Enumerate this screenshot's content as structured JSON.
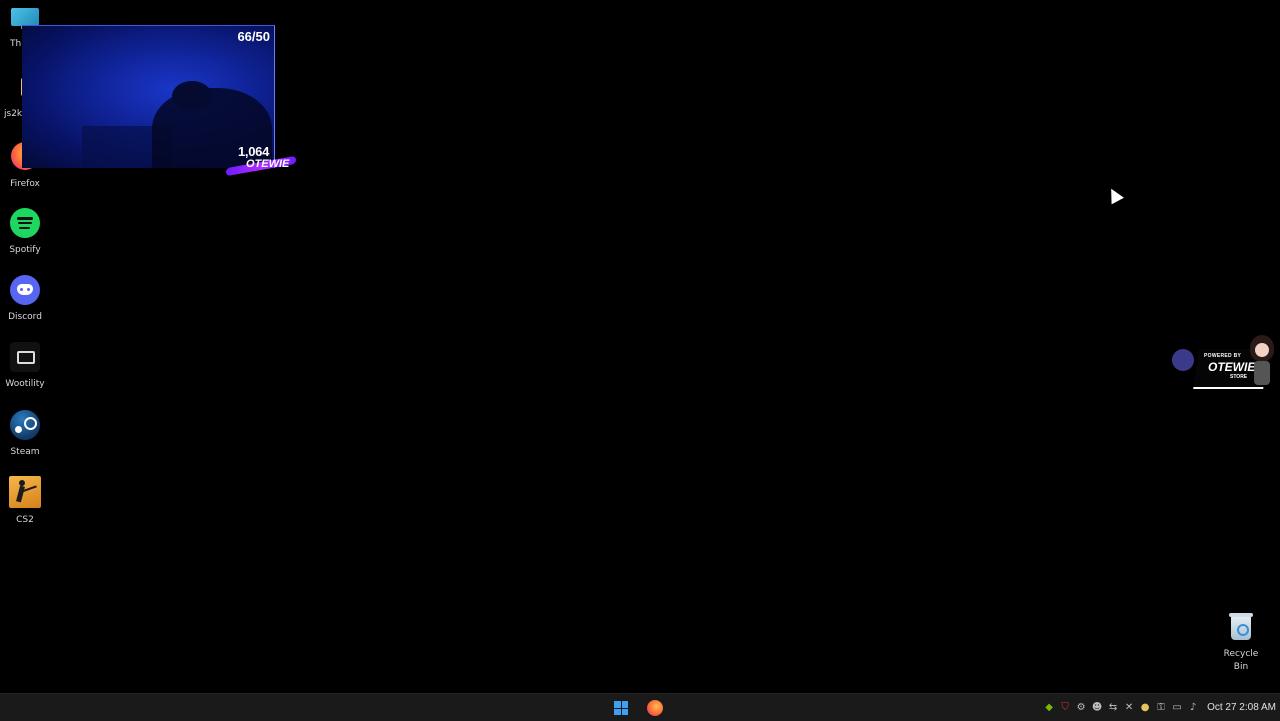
{
  "desktop": {
    "icons": [
      {
        "label": "Thi",
        "icon": "this-pc-icon"
      },
      {
        "label": "js2k",
        "icon": "folder-icon"
      },
      {
        "label": "Firefox",
        "icon": "firefox-icon"
      },
      {
        "label": "Spotify",
        "icon": "spotify-icon"
      },
      {
        "label": "Discord",
        "icon": "discord-icon"
      },
      {
        "label": "Wootility",
        "icon": "wootility-icon"
      },
      {
        "label": "Steam",
        "icon": "steam-icon"
      },
      {
        "label": "CS2",
        "icon": "cs2-icon"
      }
    ],
    "recycle_bin": {
      "label_line1": "Recycle",
      "label_line2": "Bin"
    }
  },
  "stream_overlay": {
    "goal_counter": "66/50",
    "sub_count": "1,064",
    "brand": "OTEWIE"
  },
  "powered_widget": {
    "line1": "POWERED BY",
    "name": "OTEWIE",
    "line3": "STORE"
  },
  "taskbar": {
    "clock": "Oct 27  2:08 AM",
    "pinned": [
      {
        "icon": "windows-start-icon"
      },
      {
        "icon": "firefox-icon"
      }
    ],
    "tray_icons": [
      "nvidia-icon",
      "shield-icon",
      "steam-icon",
      "discord-icon",
      "network-icon",
      "close-icon",
      "mic-icon",
      "security-icon",
      "display-icon",
      "speaker-icon"
    ]
  },
  "colors": {
    "desktop_bg": "#000000",
    "taskbar_bg": "#1a1a1a",
    "overlay_blue": "#1a36c8",
    "accent_purple": "#8a2bff"
  }
}
